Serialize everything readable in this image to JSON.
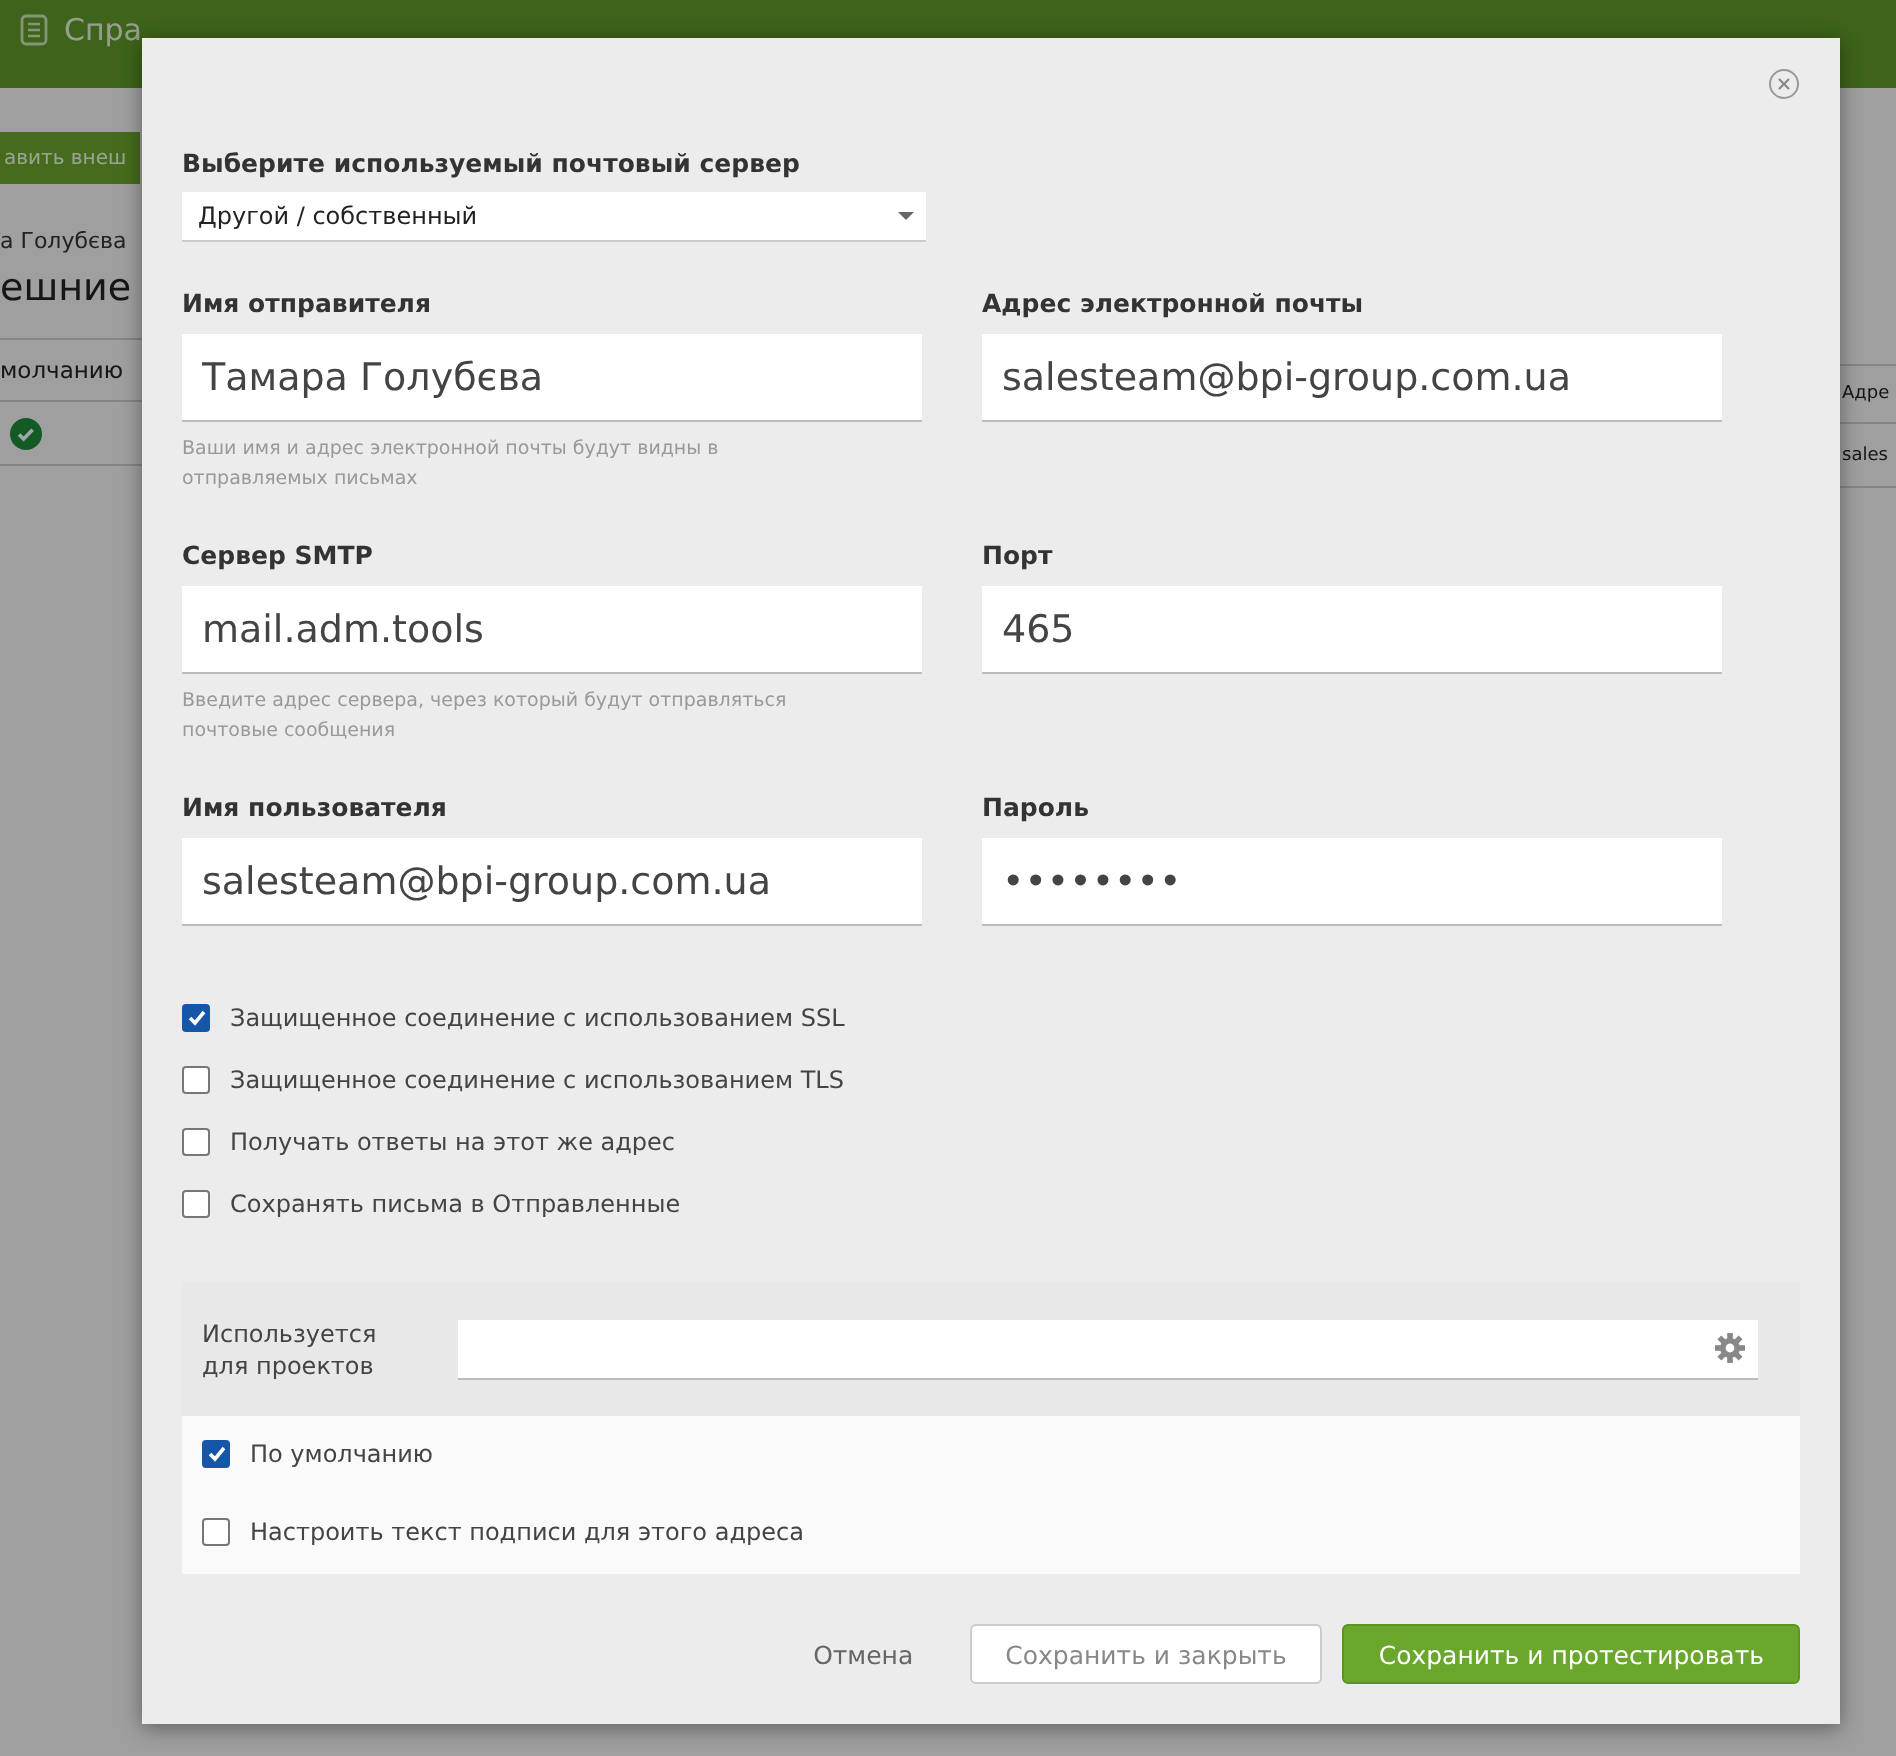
{
  "background_page": {
    "header_link": "Спра",
    "add_button": "авить внеш",
    "breadcrumb": "а Голубєва",
    "heading": "ешние",
    "table": {
      "left_header": "молчанию",
      "left_cell_checked": true,
      "right_header": "Адре",
      "right_cell": "sales"
    }
  },
  "dialog": {
    "server_label": "Выберите используемый почтовый сервер",
    "server_value": "Другой / собственный",
    "fields": [
      {
        "label": "Имя отправителя",
        "value": "Тамара Голубєва",
        "hint": "Ваши имя и адрес электронной почты будут видны в отправляемых письмах"
      },
      {
        "label": "Адрес электронной почты",
        "value": "salesteam@bpi-group.com.ua"
      },
      {
        "label": "Сервер SMTP",
        "value": "mail.adm.tools",
        "hint": "Введите адрес сервера, через который будут отправляться почтовые сообщения"
      },
      {
        "label": "Порт",
        "value": "465"
      },
      {
        "label": "Имя пользователя",
        "value": "salesteam@bpi-group.com.ua"
      },
      {
        "label": "Пароль",
        "value": "••••••••"
      }
    ],
    "options": [
      {
        "label": "Защищенное соединение с использованием SSL",
        "checked": true
      },
      {
        "label": "Защищенное соединение с использованием TLS",
        "checked": false
      },
      {
        "label": "Получать ответы на этот же адрес",
        "checked": false
      },
      {
        "label": "Сохранять письма в Отправленные",
        "checked": false
      }
    ],
    "projects_label": "Используется для проектов",
    "extra_options": [
      {
        "label": "По умолчанию",
        "checked": true
      },
      {
        "label": "Настроить текст подписи для этого адреса",
        "checked": false
      }
    ],
    "buttons": {
      "cancel": "Отмена",
      "save_close": "Сохранить и закрыть",
      "save_test": "Сохранить и протестировать"
    }
  }
}
